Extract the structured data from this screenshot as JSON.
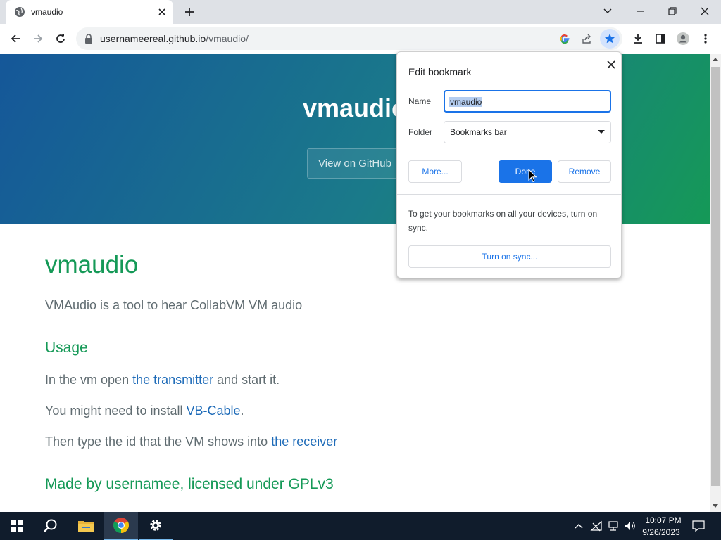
{
  "browser": {
    "tab_title": "vmaudio",
    "url_domain": "usernameereal.github.io",
    "url_path": "/vmaudio/"
  },
  "page": {
    "hero_title": "vmaudio",
    "github_button": "View on GitHub",
    "title": "vmaudio",
    "description": "VMAudio is a tool to hear CollabVM VM audio",
    "usage_heading": "Usage",
    "para1_before": "In the vm open ",
    "para1_link": "the transmitter",
    "para1_after": " and start it.",
    "para2_before": "You might need to install ",
    "para2_link": "VB-Cable",
    "para2_after": ".",
    "para3_before": "Then type the id that the VM shows into ",
    "para3_link": "the receiver",
    "made_by": "Made by usernamee, licensed under GPLv3"
  },
  "bookmark_popup": {
    "title": "Edit bookmark",
    "name_label": "Name",
    "name_value": "vmaudio",
    "folder_label": "Folder",
    "folder_value": "Bookmarks bar",
    "more_button": "More...",
    "done_button": "Done",
    "remove_button": "Remove",
    "sync_text": "To get your bookmarks on all your devices, turn on sync.",
    "sync_button": "Turn on sync..."
  },
  "taskbar": {
    "time": "10:07 PM",
    "date": "9/26/2023"
  },
  "colors": {
    "accent_blue": "#1a73e8",
    "hero_start": "#155799",
    "hero_end": "#159957",
    "heading_green": "#159957",
    "link_blue": "#1e6bb8"
  }
}
